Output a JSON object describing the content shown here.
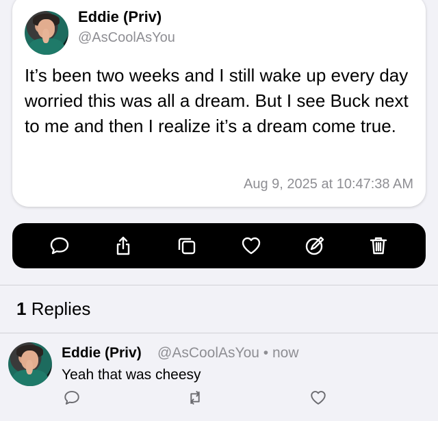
{
  "post": {
    "display_name": "Eddie (Priv)",
    "handle": "@AsCoolAsYou",
    "body": "It’s been two weeks and I still wake up every day worried this was all a dream. But I see Buck next to me and then I realize it’s a dream come true.",
    "timestamp": "Aug 9, 2025 at 10:47:38 AM"
  },
  "actions": [
    {
      "icon": "comment-icon"
    },
    {
      "icon": "share-icon"
    },
    {
      "icon": "copy-icon"
    },
    {
      "icon": "heart-icon"
    },
    {
      "icon": "edit-icon"
    },
    {
      "icon": "trash-icon"
    }
  ],
  "replies": {
    "count": "1",
    "label": "Replies"
  },
  "reply": {
    "display_name": "Eddie (Priv)",
    "meta": "@AsCoolAsYou • now",
    "text": "Yeah that was cheesy"
  },
  "colors": {
    "background": "#f2f2f7",
    "card": "#ffffff",
    "action_bar": "#000000",
    "secondary_text": "#8e8e93"
  }
}
